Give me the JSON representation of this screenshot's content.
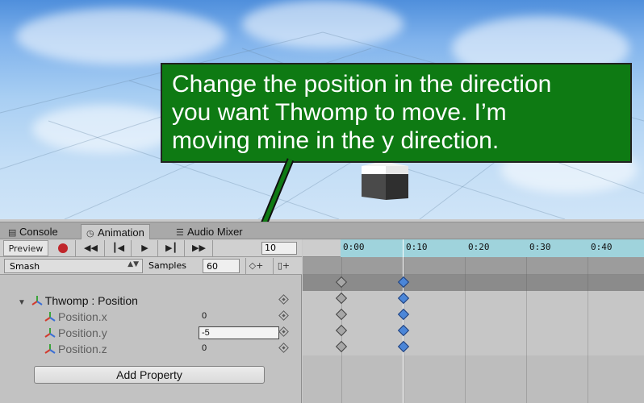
{
  "callout": {
    "text": "Change the position in the direction\nyou want Thwomp to move.  I’m\nmoving mine in the y direction."
  },
  "tabs": [
    {
      "label": "Console",
      "icon": "console-icon",
      "active": false
    },
    {
      "label": "Animation",
      "icon": "clock-icon",
      "active": true
    },
    {
      "label": "Audio Mixer",
      "icon": "mixer-icon",
      "active": false
    }
  ],
  "toolbar": {
    "preview_label": "Preview",
    "frame_value": "10",
    "clip_name": "Smash",
    "samples_label": "Samples",
    "samples_value": "60"
  },
  "properties": {
    "group_label": "Thwomp : Position",
    "rows": [
      {
        "label": "Position.x",
        "value": "0"
      },
      {
        "label": "Position.y",
        "value": "-5"
      },
      {
        "label": "Position.z",
        "value": "0"
      }
    ],
    "add_button_label": "Add Property"
  },
  "timeline": {
    "tick_labels": [
      "0:00",
      "0:10",
      "0:20",
      "0:30",
      "0:40"
    ]
  },
  "colors": {
    "callout_bg": "#0e7a13",
    "keyframe_selected": "#4b86d8",
    "record": "#c0262b"
  }
}
